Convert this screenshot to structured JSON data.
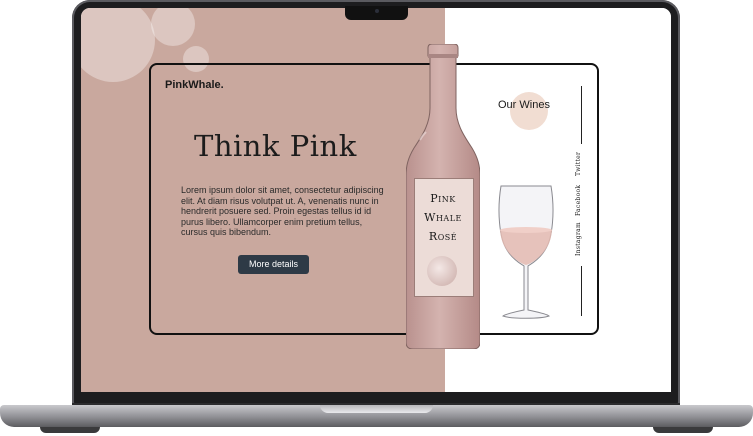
{
  "site": {
    "brand": "PinkWhale.",
    "headline": "Think Pink",
    "body_text": "Lorem ipsum dolor sit amet, consectetur adipiscing elit. At diam risus volutpat ut. A, venenatis nunc in hendrerit posuere sed. Proin egestas tellus id id purus libero. Ullamcorper enim pretium tellus, cursus quis bibendum.",
    "button_label": "More details",
    "nav_title": "Our Wines",
    "social": [
      "Instagram",
      "Facebook",
      "Twitter"
    ],
    "bottle_label": [
      "Pink",
      "Whale",
      "Rosé"
    ]
  },
  "colors": {
    "pink_panel": "#c9a89e",
    "button": "#2e3a46",
    "bottle": "#c9a3a0",
    "accent_circle": "#f1ddd2"
  }
}
